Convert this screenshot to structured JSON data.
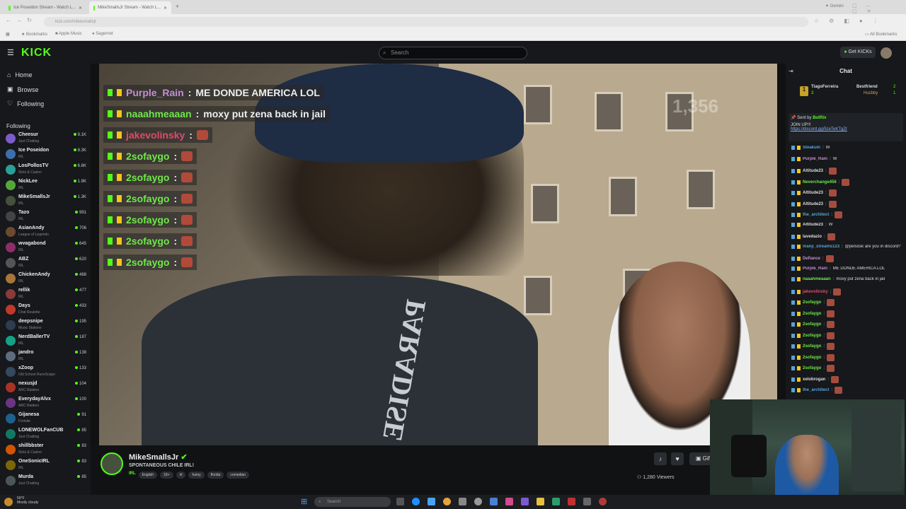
{
  "browser": {
    "tabs": [
      "Ice Poseidon Stream - Watch L...",
      "MikeSmallsJr Stream - Watch L..."
    ],
    "gemini_label": "Gemini",
    "url": "kick.com/mikesmallsjr",
    "bookmarks": [
      "Bookmarks",
      "Apple Music",
      "Sagernet"
    ],
    "all_bookmarks": "All Bookmarks"
  },
  "header": {
    "logo": "KICK",
    "search_placeholder": "Search",
    "get_kicks": "Get KICKs"
  },
  "sidebar": {
    "nav": [
      {
        "label": "Home"
      },
      {
        "label": "Browse"
      },
      {
        "label": "Following"
      }
    ],
    "following_title": "Following",
    "channels": [
      {
        "name": "Cheesur",
        "category": "Just Chatting",
        "viewers": "9.1K",
        "color": "#7b5cc8"
      },
      {
        "name": "Ice Poseidon",
        "category": "IRL",
        "viewers": "8.3K",
        "color": "#3d6fa8"
      },
      {
        "name": "LosPollosTV",
        "category": "Slots & Casino",
        "viewers": "6.8K",
        "color": "#2aa198"
      },
      {
        "name": "NickLee",
        "category": "IRL",
        "viewers": "1.9K",
        "color": "#53a83a"
      },
      {
        "name": "MikeSmallsJr",
        "category": "IRL",
        "viewers": "1.3K",
        "color": "#46513d"
      },
      {
        "name": "Tazo",
        "category": "IRL",
        "viewers": "991",
        "color": "#444"
      },
      {
        "name": "AsianAndy",
        "category": "League of Legends",
        "viewers": "706",
        "color": "#6b4a2e"
      },
      {
        "name": "wvagabond",
        "category": "IRL",
        "viewers": "645",
        "color": "#8b2e6a"
      },
      {
        "name": "ABZ",
        "category": "IRL",
        "viewers": "620",
        "color": "#555"
      },
      {
        "name": "ChickenAndy",
        "category": "IRL",
        "viewers": "488",
        "color": "#a8763a"
      },
      {
        "name": "rellik",
        "category": "IRL",
        "viewers": "477",
        "color": "#8a3a3a"
      },
      {
        "name": "Days",
        "category": "Chat Roulette",
        "viewers": "433",
        "color": "#c0392b"
      },
      {
        "name": "deepsnipe",
        "category": "Music Stations",
        "viewers": "195",
        "color": "#2c3e50"
      },
      {
        "name": "NerdBallerTV",
        "category": "IRL",
        "viewers": "187",
        "color": "#16a085"
      },
      {
        "name": "jandro",
        "category": "IRL",
        "viewers": "138",
        "color": "#5d6d7e"
      },
      {
        "name": "xZoop",
        "category": "Old School RuneScape",
        "viewers": "133",
        "color": "#34495e"
      },
      {
        "name": "nexusjd",
        "category": "ARC Raiders",
        "viewers": "104",
        "color": "#a93226"
      },
      {
        "name": "EverydayAlvx",
        "category": "ARC Raiders",
        "viewers": "100",
        "color": "#6c3483"
      },
      {
        "name": "Gijanesa",
        "category": "Fortnite",
        "viewers": "91",
        "color": "#1f618d"
      },
      {
        "name": "LONEWOLFanCUB",
        "category": "Just Chatting",
        "viewers": "85",
        "color": "#117864"
      },
      {
        "name": "shillbbster",
        "category": "Slots & Casino",
        "viewers": "83",
        "color": "#d35400"
      },
      {
        "name": "OneSonicIRL",
        "category": "IRL",
        "viewers": "83",
        "color": "#7d6608"
      },
      {
        "name": "Murda",
        "category": "Just Chatting",
        "viewers": "85",
        "color": "#4d5656"
      }
    ]
  },
  "video": {
    "overlay_viewers": "1,356",
    "overlay_chat": [
      {
        "user": "Purple_Rain",
        "msg": "ME DONDE AMERICA LOL",
        "color": "#c38ed1",
        "emote": false
      },
      {
        "user": "naaahmeaaan",
        "msg": "moxy put zena back in jail",
        "color": "#6fe84a",
        "emote": false
      },
      {
        "user": "jakevolinsky",
        "msg": "",
        "color": "#e14a6b",
        "emote": true
      },
      {
        "user": "2sofaygo",
        "msg": "",
        "color": "#6fe84a",
        "emote": true
      },
      {
        "user": "2sofaygo",
        "msg": "",
        "color": "#6fe84a",
        "emote": true
      },
      {
        "user": "2sofaygo",
        "msg": "",
        "color": "#6fe84a",
        "emote": true
      },
      {
        "user": "2sofaygo",
        "msg": "",
        "color": "#6fe84a",
        "emote": true
      },
      {
        "user": "2sofaygo",
        "msg": "",
        "color": "#6fe84a",
        "emote": true
      },
      {
        "user": "2sofaygo",
        "msg": "",
        "color": "#6fe84a",
        "emote": true
      }
    ],
    "shirt_text": "PARADISE"
  },
  "chat": {
    "title": "Chat",
    "top_gifters": [
      {
        "name": "TiagoFerreira",
        "count": "3"
      },
      {
        "name": "Bestfriend",
        "count": "2"
      },
      {
        "name": "Huzbby",
        "count": "1"
      }
    ],
    "pinned_by": "Sent by",
    "pinned_author": "BotRix",
    "pinned_text": "JOIN UP!!!",
    "pinned_link": "https://discord.gg/5zeTeKTgZr",
    "messages": [
      {
        "user": "Steakum",
        "msg": "W",
        "color": "#57a3d6",
        "emote": false
      },
      {
        "user": "Purple_Rain",
        "msg": "W",
        "color": "#c38ed1",
        "emote": false
      },
      {
        "user": "Altitude23",
        "msg": "",
        "color": "#ddd",
        "emote": true
      },
      {
        "user": "Neverchange456",
        "msg": "",
        "color": "#6fe84a",
        "emote": true
      },
      {
        "user": "Altitude23",
        "msg": "",
        "color": "#ddd",
        "emote": true
      },
      {
        "user": "Altitude23",
        "msg": "",
        "color": "#ddd",
        "emote": true
      },
      {
        "user": "the_architect",
        "msg": "",
        "color": "#57a3d6",
        "emote": true
      },
      {
        "user": "Altitude23",
        "msg": "W",
        "color": "#ddd",
        "emote": false
      },
      {
        "user": "lavedazio",
        "msg": "",
        "color": "#ddd",
        "emote": true
      },
      {
        "user": "manji_streams123",
        "msg": "@pelsosk are you in discord?",
        "color": "#57a3d6",
        "emote": false
      },
      {
        "user": "Defiance",
        "msg": "",
        "color": "#c38ed1",
        "emote": true
      },
      {
        "user": "Purple_Rain",
        "msg": "ME DONDE AMERICA LOL",
        "color": "#c38ed1",
        "emote": false
      },
      {
        "user": "naaahmeaaan",
        "msg": "moxy put zena back in jail",
        "color": "#6fe84a",
        "emote": false
      },
      {
        "user": "jakevolinsky",
        "msg": "",
        "color": "#e14a6b",
        "emote": true
      },
      {
        "user": "2sofaygo",
        "msg": "",
        "color": "#6fe84a",
        "emote": true
      },
      {
        "user": "2sofaygo",
        "msg": "",
        "color": "#6fe84a",
        "emote": true
      },
      {
        "user": "2sofaygo",
        "msg": "",
        "color": "#6fe84a",
        "emote": true
      },
      {
        "user": "2sofaygo",
        "msg": "",
        "color": "#6fe84a",
        "emote": true
      },
      {
        "user": "2sofaygo",
        "msg": "",
        "color": "#6fe84a",
        "emote": true
      },
      {
        "user": "2sofaygo",
        "msg": "",
        "color": "#6fe84a",
        "emote": true
      },
      {
        "user": "2sofaygo",
        "msg": "",
        "color": "#6fe84a",
        "emote": true
      },
      {
        "user": "xelobrogan",
        "msg": "",
        "color": "#ddd",
        "emote": true
      },
      {
        "user": "the_architect",
        "msg": "",
        "color": "#57a3d6",
        "emote": true
      }
    ]
  },
  "stream": {
    "name": "MikeSmallsJr",
    "title": "SPONTANEOUS CHILE IRL!",
    "category": "IRL",
    "tags": [
      "English",
      "18+",
      "irl",
      "funny",
      "florida",
      "comedian"
    ],
    "viewers": "1,280 Viewers",
    "gift_label": "Gift"
  },
  "taskbar": {
    "weather_temp": "59°F",
    "weather_desc": "Mostly cloudy",
    "search_placeholder": "Search"
  },
  "colors": {
    "accent": "#53fc18",
    "bg": "#16181b"
  }
}
